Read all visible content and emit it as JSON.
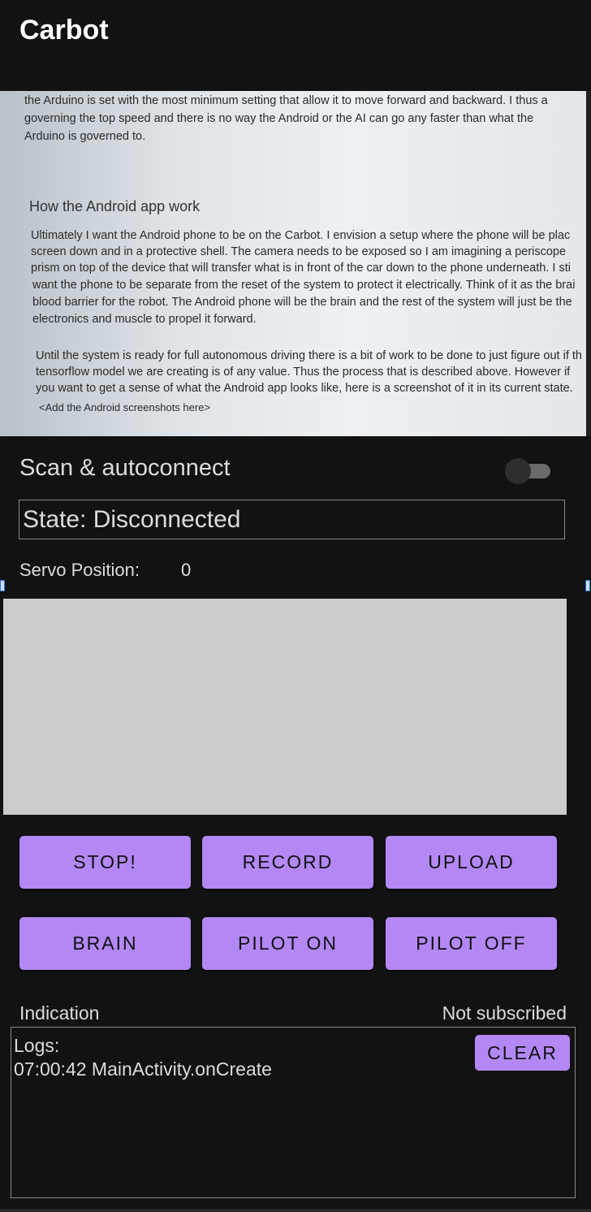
{
  "app": {
    "title": "Carbot"
  },
  "camera": {
    "lines": [
      "the Arduino is set with the most minimum setting that allow it to move forward and backward. I thus a",
      "governing the top speed and there is no way the Android or the AI can go any faster than what the",
      "Arduino is governed to."
    ],
    "heading": "How the Android app work",
    "para1": [
      "Ultimately I want the Android phone to be on the Carbot. I envision a setup where the phone will be plac",
      "screen down and in a protective shell. The camera needs to be exposed so I am imagining a periscope",
      "prism on top of the device that will transfer what is in front of the car down to the phone underneath. I sti",
      "want the phone to be separate from the reset of the system to protect it electrically. Think of it as the brai",
      "blood barrier for the robot. The Android phone will be the brain and the rest of the system will just be the",
      "electronics and muscle to propel it forward."
    ],
    "para2": [
      "Until the system is ready for full autonomous driving there is a bit of work to be done to just figure out if th",
      "tensorflow model we are creating is of any value. Thus the process that is described above.  However if",
      "you want to get a sense of what the Android app looks like, here is a screenshot of it in its current state."
    ],
    "placeholder": "<Add the Android screenshots here>"
  },
  "scan": {
    "label": "Scan & autoconnect",
    "enabled": false
  },
  "state": {
    "text": "State: Disconnected"
  },
  "servo": {
    "label": "Servo Position:",
    "value": "0"
  },
  "buttons": {
    "row1": [
      "STOP!",
      "RECORD",
      "UPLOAD"
    ],
    "row2": [
      "BRAIN",
      "PILOT ON",
      "PILOT OFF"
    ]
  },
  "indication": {
    "label": "Indication",
    "status": "Not subscribed"
  },
  "logs": {
    "title": "Logs:",
    "entries": [
      "07:00:42 MainActivity.onCreate"
    ],
    "clear_label": "CLEAR"
  },
  "colors": {
    "accent": "#b388f5",
    "background": "#121212",
    "preview": "#cccccc"
  }
}
